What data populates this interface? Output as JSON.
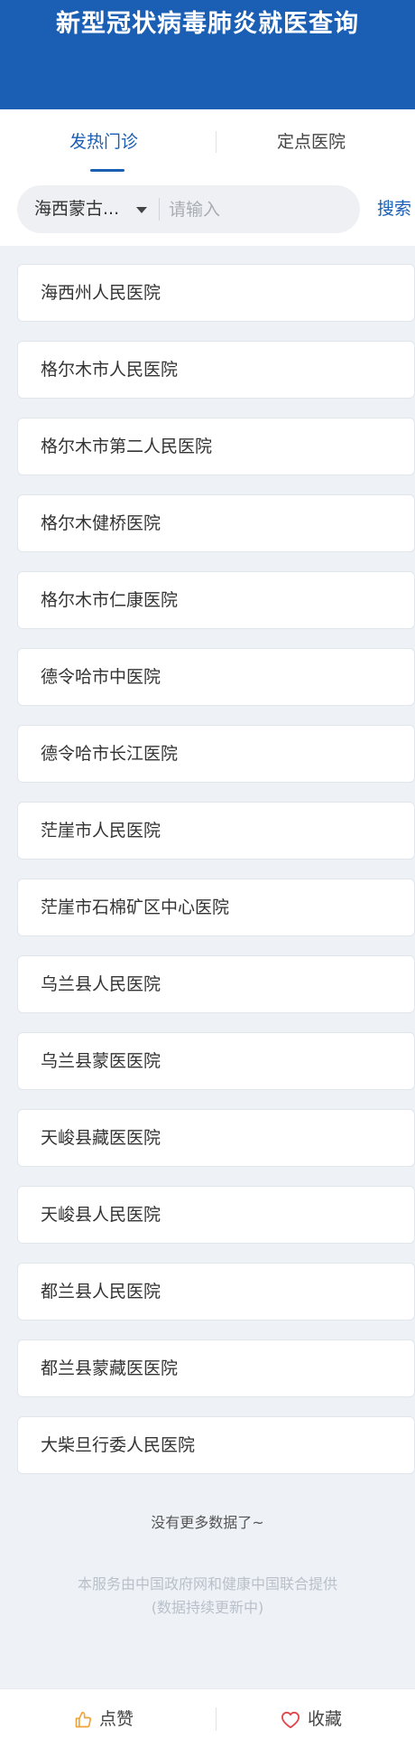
{
  "header": {
    "title": "新型冠状病毒肺炎就医查询",
    "bg_color": "#1a5fb4"
  },
  "tabs": [
    {
      "label": "发热门诊",
      "active": true
    },
    {
      "label": "定点医院",
      "active": false
    }
  ],
  "search": {
    "region": "海西蒙古...",
    "placeholder": "请输入",
    "value": "",
    "button_label": "搜索"
  },
  "hospitals": [
    "海西州人民医院",
    "格尔木市人民医院",
    "格尔木市第二人民医院",
    "格尔木健桥医院",
    "格尔木市仁康医院",
    "德令哈市中医院",
    "德令哈市长江医院",
    "茫崖市人民医院",
    "茫崖市石棉矿区中心医院",
    "乌兰县人民医院",
    "乌兰县蒙医医院",
    "天峻县藏医医院",
    "天峻县人民医院",
    "都兰县人民医院",
    "都兰县蒙藏医医院",
    "大柴旦行委人民医院"
  ],
  "list_end_text": "没有更多数据了~",
  "footer": {
    "line1": "本服务由中国政府网和健康中国联合提供",
    "line2": "(数据持续更新中)"
  },
  "bottom_bar": {
    "like_label": "点赞",
    "like_icon": "thumbs-up-icon",
    "favorite_label": "收藏",
    "favorite_icon": "heart-icon"
  },
  "colors": {
    "accent": "#1a5fb4",
    "heart": "#e0464a",
    "thumb": "#f0a33a"
  }
}
